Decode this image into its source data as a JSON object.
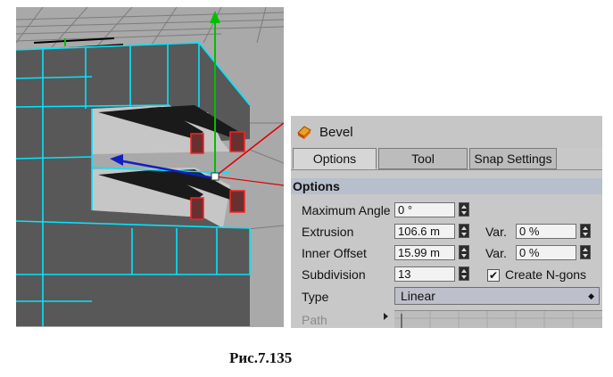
{
  "panel": {
    "title": "Bevel",
    "tabs": [
      {
        "label": "Options",
        "active": true
      },
      {
        "label": "Tool",
        "active": false
      },
      {
        "label": "Snap Settings",
        "active": false
      }
    ],
    "section_title": "Options",
    "fields": {
      "maximum_angle": {
        "label": "Maximum Angle",
        "value": "0 °"
      },
      "extrusion": {
        "label": "Extrusion",
        "value": "106.6 m",
        "var_label": "Var.",
        "var_value": "0 %"
      },
      "inner_offset": {
        "label": "Inner Offset",
        "value": "15.99 m",
        "var_label": "Var.",
        "var_value": "0 %"
      },
      "subdivision": {
        "label": "Subdivision",
        "value": "13"
      },
      "create_ngons": {
        "label": "Create N-gons",
        "checked": true
      },
      "type": {
        "label": "Type",
        "value": "Linear"
      },
      "path": {
        "label": "Path"
      }
    }
  },
  "icons": {
    "title_icon": "bevel-tool-icon",
    "spinner": "spinner-arrows-icon",
    "checkbox_mark": "✔",
    "dropdown_arrow": "◆"
  },
  "colors": {
    "viewport_bg": "#a9a9a9",
    "edge_cyan": "#00e5ff",
    "axis_green": "#00c000",
    "axis_red": "#e00000",
    "axis_blue": "#1020c0",
    "panel_bg": "#c8c8c8",
    "section_bg": "#b7bfcc"
  },
  "caption": "Рис.7.135"
}
